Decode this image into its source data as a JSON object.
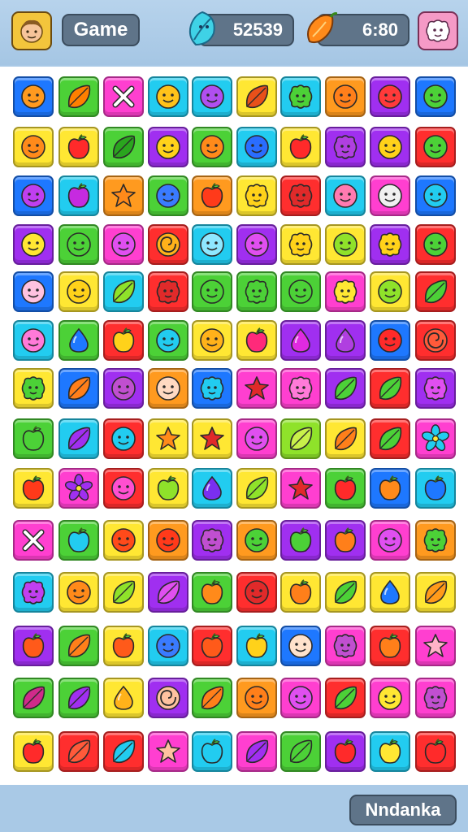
{
  "header": {
    "game_label": "Game",
    "gem_count": "52539",
    "timer": "6:80",
    "avatar_icon": "player-face-icon",
    "gem_icon": "blue-gem-leaf-icon",
    "time_icon": "orange-pepper-icon",
    "pause_icon": "pink-blob-face-icon"
  },
  "footer": {
    "button_label": "Nndanka"
  },
  "palette": {
    "o": "#ff9a1f",
    "g": "#4cd137",
    "m": "#ff3fd0",
    "p": "#a02ff0",
    "c": "#22ccf0",
    "y": "#ffe733",
    "b": "#1e78ff",
    "r": "#ff2e2e",
    "l": "#8fe22a",
    "k": "#ff7ad9"
  },
  "board": {
    "rows": [
      [
        [
          "b",
          "face",
          "#ff9a1f"
        ],
        [
          "g",
          "leaf",
          "#ff7f00"
        ],
        [
          "m",
          "cross",
          "#ffffff"
        ],
        [
          "c",
          "face",
          "#ffc21a"
        ],
        [
          "c",
          "face",
          "#b04ff0"
        ],
        [
          "y",
          "leaf",
          "#e8501a"
        ],
        [
          "c",
          "blob",
          "#4cd137"
        ],
        [
          "o",
          "face",
          "#ff7f1a"
        ],
        [
          "p",
          "face",
          "#ff3a3a"
        ],
        [
          "b",
          "face",
          "#4cd137"
        ]
      ],
      [
        [
          "y",
          "face",
          "#ff8a1a"
        ],
        [
          "y",
          "apple",
          "#ff2a2a"
        ],
        [
          "g",
          "leaf",
          "#2aa51e"
        ],
        [
          "p",
          "face",
          "#ffd21a"
        ],
        [
          "g",
          "face",
          "#ff8a1a"
        ],
        [
          "c",
          "face",
          "#2a6dff"
        ],
        [
          "y",
          "apple",
          "#ff2a2a"
        ],
        [
          "p",
          "blob",
          "#b03fe0"
        ],
        [
          "p",
          "face",
          "#ffd21a"
        ],
        [
          "r",
          "face",
          "#4cd137"
        ]
      ],
      [
        [
          "b",
          "face",
          "#c03ff0"
        ],
        [
          "c",
          "apple",
          "#c62ae0"
        ],
        [
          "o",
          "star",
          "#ff8a1a"
        ],
        [
          "g",
          "face",
          "#3a7bff"
        ],
        [
          "o",
          "apple",
          "#ff3a1a"
        ],
        [
          "y",
          "blob",
          "#ffd21a"
        ],
        [
          "r",
          "blob",
          "#e02a2a"
        ],
        [
          "c",
          "face",
          "#ff7ab0"
        ],
        [
          "m",
          "face",
          "#f0f0f0"
        ],
        [
          "b",
          "face",
          "#22ccf0"
        ]
      ],
      [
        [
          "p",
          "face",
          "#ffe733"
        ],
        [
          "g",
          "face",
          "#4cd137"
        ],
        [
          "m",
          "face",
          "#e04ff0"
        ],
        [
          "r",
          "swirl",
          "#ffb21a"
        ],
        [
          "c",
          "face",
          "#8fe8ff"
        ],
        [
          "p",
          "face",
          "#e04ff0"
        ],
        [
          "y",
          "blob",
          "#ffd21a"
        ],
        [
          "y",
          "face",
          "#8fe22a"
        ],
        [
          "p",
          "blob",
          "#ffd21a"
        ],
        [
          "r",
          "face",
          "#4cd137"
        ]
      ],
      [
        [
          "b",
          "face",
          "#ffc2e0"
        ],
        [
          "y",
          "face",
          "#ffd21a"
        ],
        [
          "c",
          "leaf",
          "#8fe22a"
        ],
        [
          "r",
          "blob",
          "#e02a2a"
        ],
        [
          "g",
          "face",
          "#4cd137"
        ],
        [
          "g",
          "blob",
          "#4cd137"
        ],
        [
          "g",
          "face",
          "#4cd137"
        ],
        [
          "m",
          "blob",
          "#ffe733"
        ],
        [
          "y",
          "face",
          "#8fe22a"
        ],
        [
          "r",
          "leaf",
          "#4cd137"
        ]
      ],
      [
        [
          "c",
          "face",
          "#ff7ad9"
        ],
        [
          "g",
          "drop",
          "#1e78ff"
        ],
        [
          "r",
          "apple",
          "#ffd21a"
        ],
        [
          "g",
          "face",
          "#22ccf0"
        ],
        [
          "y",
          "face",
          "#ffb21a"
        ],
        [
          "y",
          "apple",
          "#ff2a7a"
        ],
        [
          "p",
          "drop",
          "#e02ae0"
        ],
        [
          "p",
          "drop",
          "#b03fe0"
        ],
        [
          "b",
          "face",
          "#ff2a2a"
        ],
        [
          "r",
          "swirl",
          "#ff5a3a"
        ]
      ],
      [
        [
          "y",
          "blob",
          "#4cd137"
        ],
        [
          "b",
          "leaf",
          "#ff7f1a"
        ],
        [
          "p",
          "face",
          "#c04fd0"
        ],
        [
          "o",
          "face",
          "#ffd9c2"
        ],
        [
          "b",
          "blob",
          "#22ccf0"
        ],
        [
          "m",
          "star",
          "#e02a2a"
        ],
        [
          "m",
          "blob",
          "#ff7ad9"
        ],
        [
          "p",
          "leaf",
          "#4cd137"
        ],
        [
          "r",
          "leaf",
          "#4cd137"
        ],
        [
          "p",
          "blob",
          "#e04ff0"
        ]
      ],
      [
        [
          "g",
          "apple",
          "#4cd137"
        ],
        [
          "c",
          "leaf",
          "#a02ff0"
        ],
        [
          "r",
          "face",
          "#22ccf0"
        ],
        [
          "y",
          "star",
          "#ff8a1a"
        ],
        [
          "y",
          "star",
          "#e02a2a"
        ],
        [
          "m",
          "face",
          "#e04ff0"
        ],
        [
          "l",
          "leaf",
          "#c8f04a"
        ],
        [
          "y",
          "leaf",
          "#ff7f1a"
        ],
        [
          "r",
          "leaf",
          "#4cd137"
        ],
        [
          "m",
          "flower",
          "#22ccf0"
        ]
      ],
      [
        [
          "y",
          "apple",
          "#ff3a1a"
        ],
        [
          "m",
          "flower",
          "#a02ff0"
        ],
        [
          "r",
          "face",
          "#ff4fd0"
        ],
        [
          "y",
          "apple",
          "#8fe22a"
        ],
        [
          "c",
          "drop",
          "#7a2ff0"
        ],
        [
          "y",
          "leaf",
          "#8fe22a"
        ],
        [
          "m",
          "star",
          "#e02a2a"
        ],
        [
          "g",
          "apple",
          "#ff2a2a"
        ],
        [
          "b",
          "apple",
          "#ff8a1a"
        ],
        [
          "c",
          "apple",
          "#1e78ff"
        ]
      ],
      [
        [
          "m",
          "cross",
          "#ffffff"
        ],
        [
          "g",
          "apple",
          "#22ccf0"
        ],
        [
          "y",
          "face",
          "#ff4a1a"
        ],
        [
          "o",
          "face",
          "#ff3a1a"
        ],
        [
          "p",
          "blob",
          "#c04fd0"
        ],
        [
          "o",
          "face",
          "#4cd137"
        ],
        [
          "p",
          "apple",
          "#4cd137"
        ],
        [
          "p",
          "apple",
          "#ff7f1a"
        ],
        [
          "m",
          "face",
          "#e04ff0"
        ],
        [
          "o",
          "blob",
          "#4cd137"
        ]
      ],
      [
        [
          "c",
          "blob",
          "#c03ff0"
        ],
        [
          "y",
          "face",
          "#ff8a1a"
        ],
        [
          "y",
          "leaf",
          "#8fe22a"
        ],
        [
          "p",
          "leaf",
          "#e04ff0"
        ],
        [
          "g",
          "apple",
          "#ff8a1a"
        ],
        [
          "r",
          "face",
          "#e02a2a"
        ],
        [
          "y",
          "apple",
          "#ff7f1a"
        ],
        [
          "y",
          "leaf",
          "#4cd137"
        ],
        [
          "y",
          "drop",
          "#1e78ff"
        ],
        [
          "y",
          "leaf",
          "#ff9a1a"
        ]
      ],
      [
        [
          "p",
          "apple",
          "#ff5a1a"
        ],
        [
          "g",
          "leaf",
          "#ff7f1a"
        ],
        [
          "y",
          "apple",
          "#ff5a1a"
        ],
        [
          "c",
          "face",
          "#3a7bff"
        ],
        [
          "r",
          "apple",
          "#ff5a1a"
        ],
        [
          "c",
          "apple",
          "#ffd21a"
        ],
        [
          "b",
          "face",
          "#ffe2cc"
        ],
        [
          "m",
          "blob",
          "#c04fd0"
        ],
        [
          "r",
          "apple",
          "#ff7f1a"
        ],
        [
          "m",
          "star",
          "#ffb2c8"
        ]
      ],
      [
        [
          "g",
          "leaf",
          "#d02a8a"
        ],
        [
          "g",
          "leaf",
          "#a02ff0"
        ],
        [
          "y",
          "drop",
          "#ffb21a"
        ],
        [
          "p",
          "swirl",
          "#ffc2a0"
        ],
        [
          "g",
          "leaf",
          "#ff7f1a"
        ],
        [
          "o",
          "face",
          "#ff7f1a"
        ],
        [
          "m",
          "face",
          "#e04ff0"
        ],
        [
          "r",
          "leaf",
          "#4cd137"
        ],
        [
          "m",
          "face",
          "#ffe733"
        ],
        [
          "m",
          "blob",
          "#c04fd0"
        ]
      ],
      [
        [
          "y",
          "apple",
          "#ff2a2a"
        ],
        [
          "r",
          "leaf",
          "#ff5a3a"
        ],
        [
          "r",
          "leaf",
          "#22ccf0"
        ],
        [
          "m",
          "star",
          "#ffc2a0"
        ],
        [
          "c",
          "apple",
          "#22ccf0"
        ],
        [
          "m",
          "leaf",
          "#a02ff0"
        ],
        [
          "g",
          "leaf",
          "#4cd137"
        ],
        [
          "p",
          "apple",
          "#ff2a2a"
        ],
        [
          "c",
          "apple",
          "#ffe733"
        ],
        [
          "r",
          "apple",
          "#ff2a2a"
        ]
      ]
    ]
  }
}
